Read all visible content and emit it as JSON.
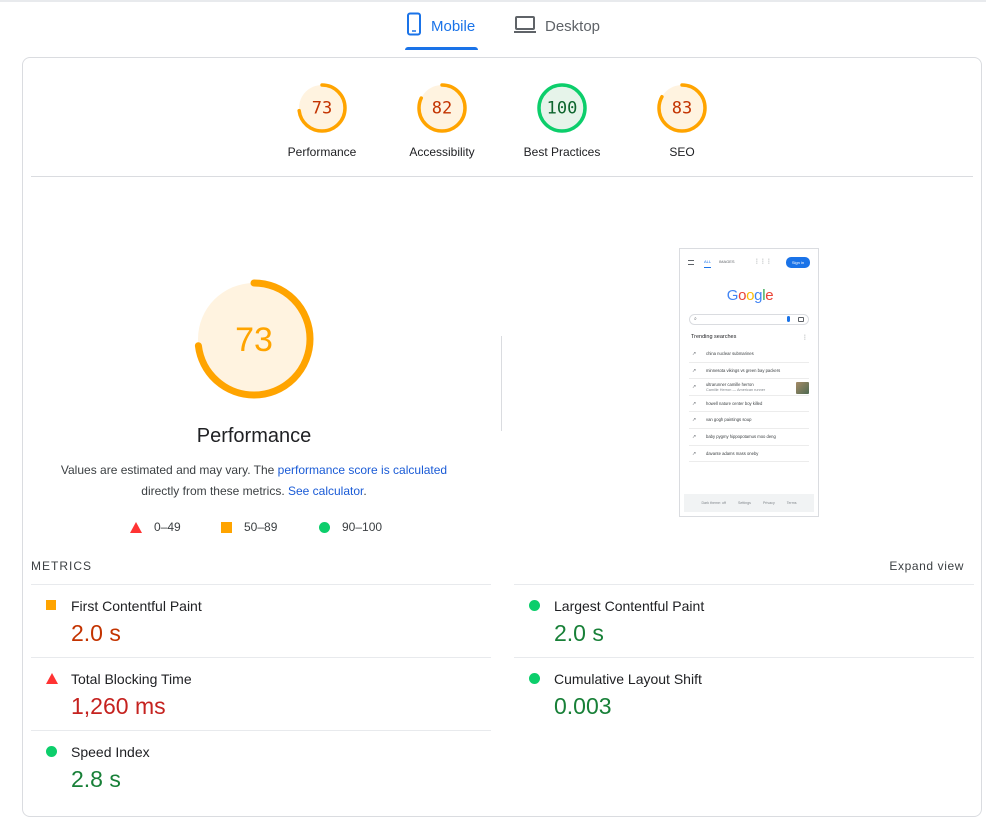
{
  "tabs": [
    {
      "label": "Mobile",
      "icon": "smartphone-icon",
      "active": true
    },
    {
      "label": "Desktop",
      "icon": "laptop-icon",
      "active": false
    }
  ],
  "categories": [
    {
      "name": "Performance",
      "score": 73,
      "status": "average"
    },
    {
      "name": "Accessibility",
      "score": 82,
      "status": "average"
    },
    {
      "name": "Best Practices",
      "score": 100,
      "status": "pass"
    },
    {
      "name": "SEO",
      "score": 83,
      "status": "average"
    }
  ],
  "performance": {
    "score": 73,
    "title": "Performance",
    "desc_prefix": "Values are estimated and may vary. The ",
    "desc_link1": "performance score is calculated",
    "desc_middle": "directly from these metrics. ",
    "desc_link2": "See calculator",
    "desc_suffix": "."
  },
  "legend": [
    {
      "range": "0–49",
      "shape": "triangle",
      "color": "#ff3333"
    },
    {
      "range": "50–89",
      "shape": "square",
      "color": "#ffa400"
    },
    {
      "range": "90–100",
      "shape": "circle",
      "color": "#0cce6b"
    }
  ],
  "colors": {
    "accent": "#1a73e8",
    "average": "#ffa400",
    "average_bg": "#fff3e0",
    "pass": "#0cce6b",
    "pass_bg": "#e6f4ea",
    "fail": "#ff3333"
  },
  "screenshot": {
    "nav_all": "ALL",
    "nav_images": "IMAGES",
    "sign_in": "Sign in",
    "logo": "Google",
    "trending_title": "Trending searches",
    "items": [
      {
        "title": "china nuclear submarines",
        "sub": ""
      },
      {
        "title": "minnesota vikings vs green bay packers",
        "sub": ""
      },
      {
        "title": "ultrarunner camille herron",
        "sub": "Camille Herron — American runner",
        "thumb": true
      },
      {
        "title": "howell nature center boy killed",
        "sub": ""
      },
      {
        "title": "van gogh paintings soup",
        "sub": ""
      },
      {
        "title": "baby pygmy hippopotamus moo deng",
        "sub": ""
      },
      {
        "title": "davante adams mass oneby",
        "sub": ""
      }
    ],
    "footer": [
      "Dark theme: off",
      "Settings",
      "Privacy",
      "Terms"
    ]
  },
  "metrics": {
    "heading": "METRICS",
    "expand_label": "Expand view",
    "items": [
      {
        "name": "First Contentful Paint",
        "value": "2.0 s",
        "status": "average"
      },
      {
        "name": "Largest Contentful Paint",
        "value": "2.0 s",
        "status": "pass"
      },
      {
        "name": "Total Blocking Time",
        "value": "1,260 ms",
        "status": "fail"
      },
      {
        "name": "Cumulative Layout Shift",
        "value": "0.003",
        "status": "pass"
      },
      {
        "name": "Speed Index",
        "value": "2.8 s",
        "status": "pass"
      }
    ]
  }
}
